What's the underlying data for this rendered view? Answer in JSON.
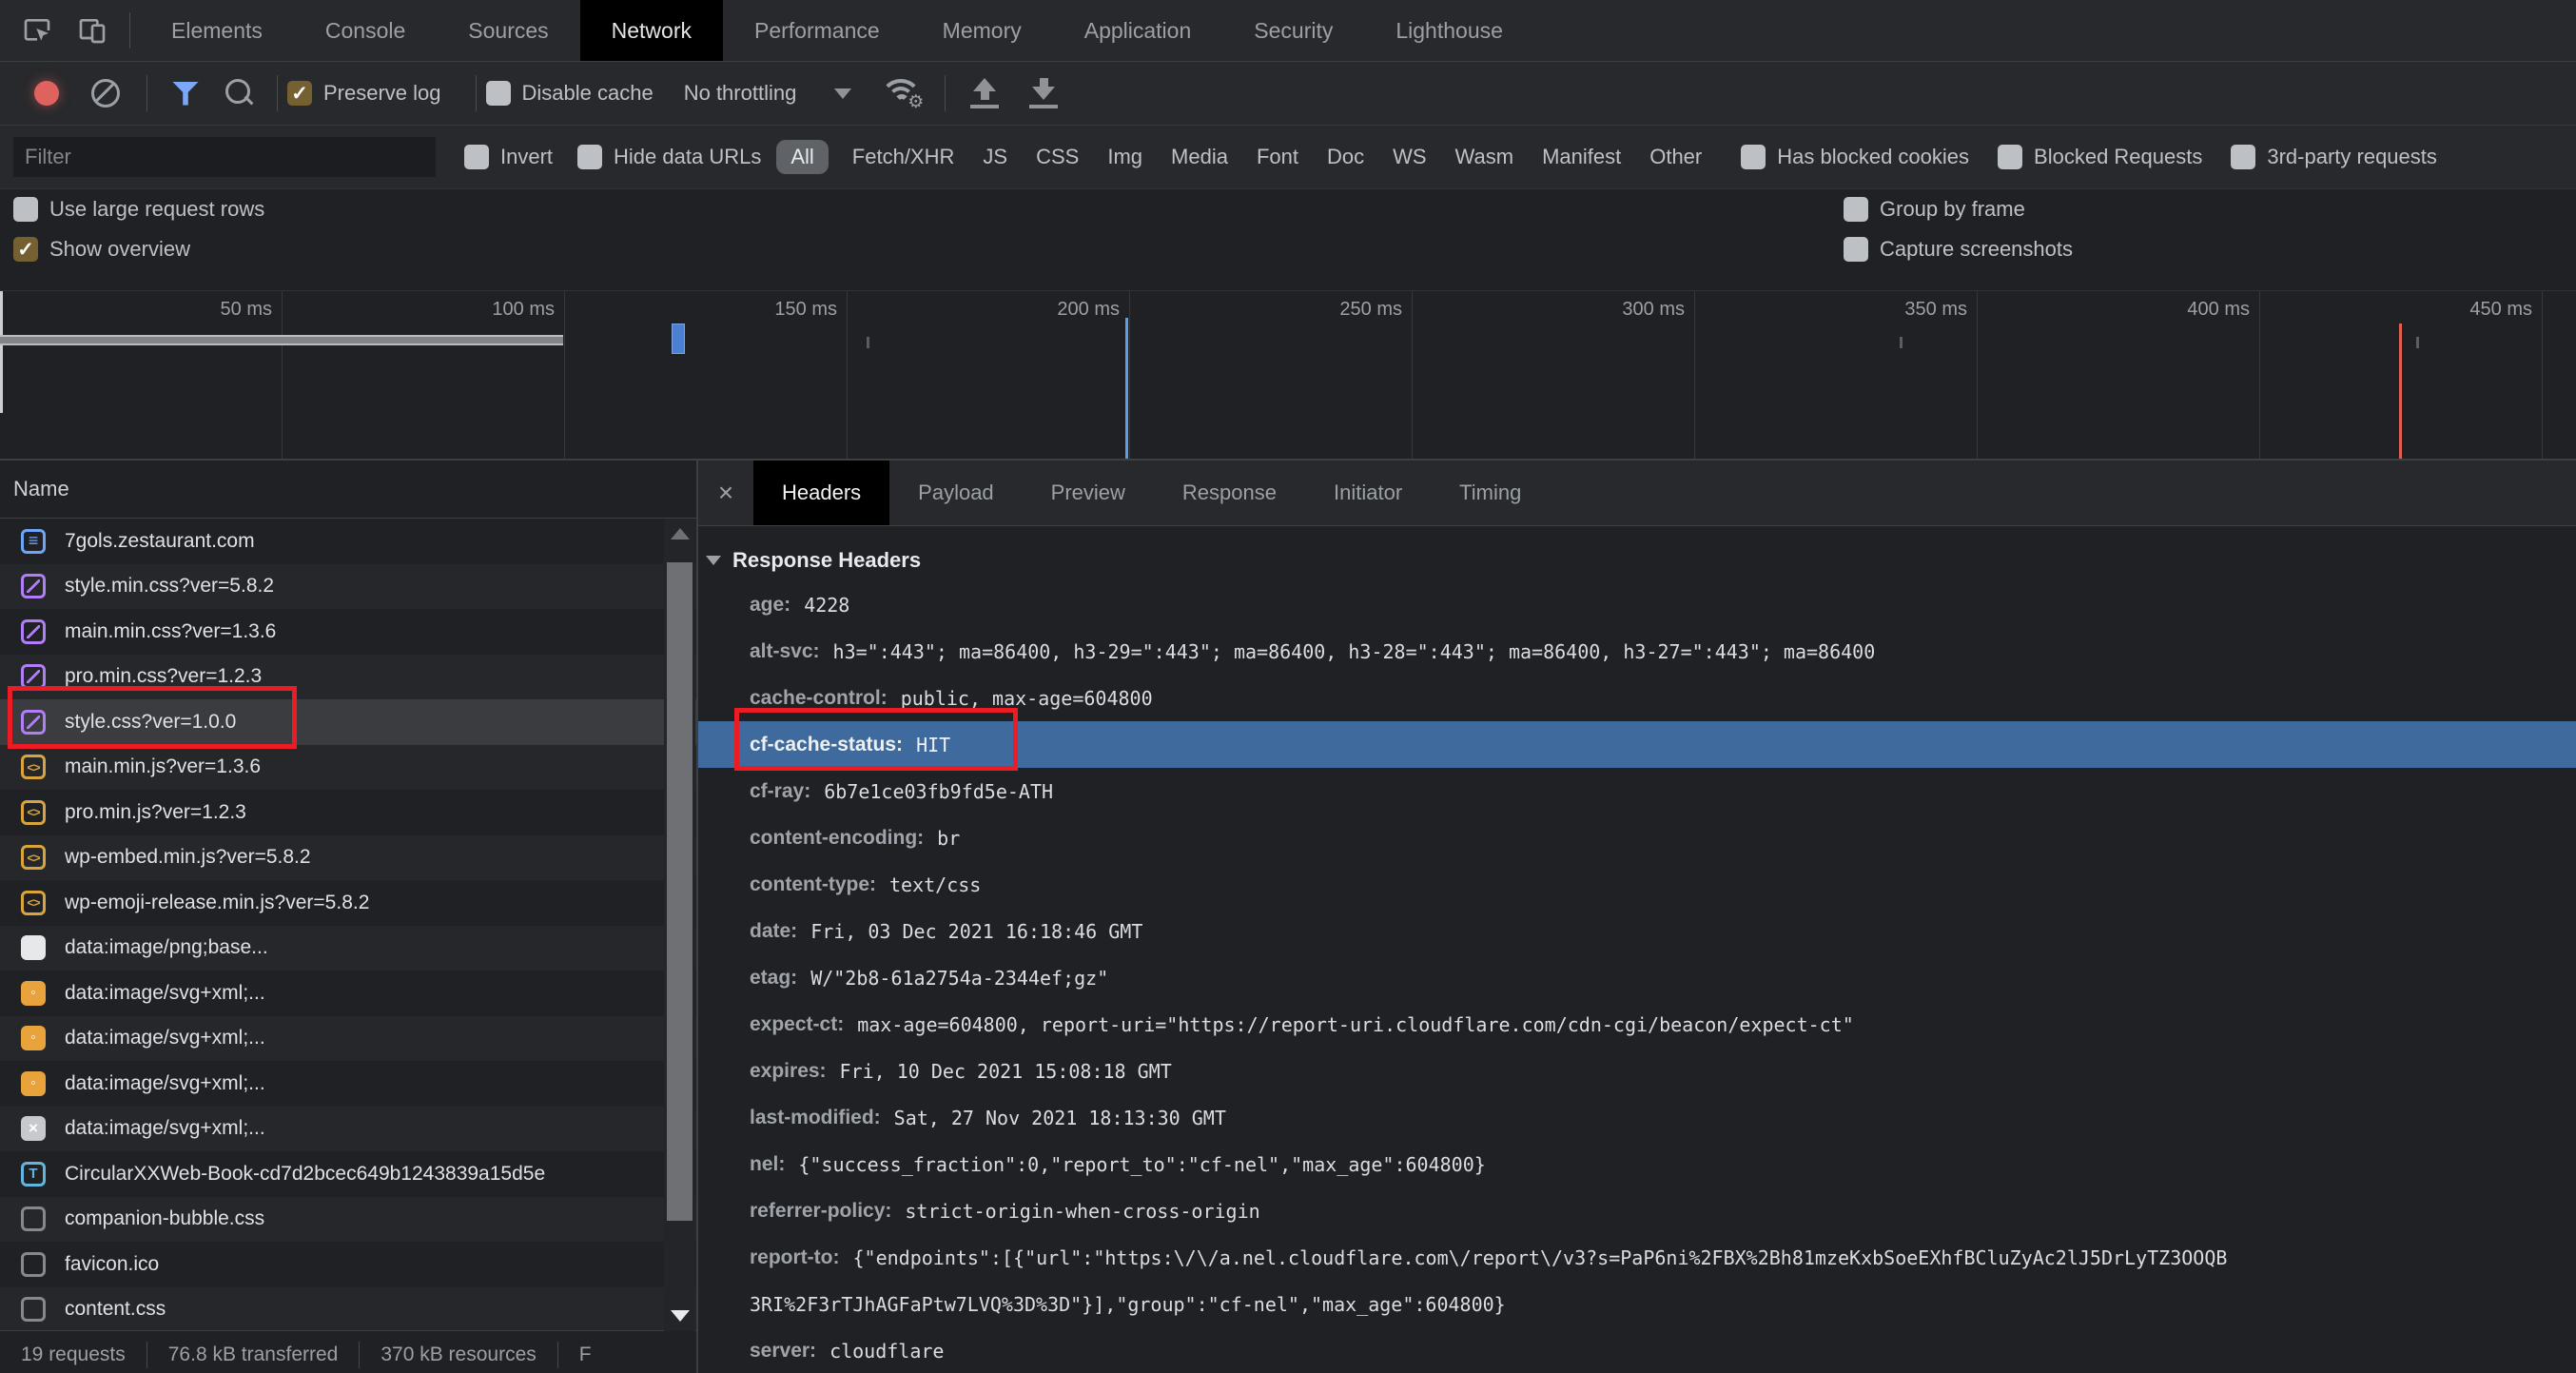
{
  "main_tabs": {
    "items": [
      "Elements",
      "Console",
      "Sources",
      "Network",
      "Performance",
      "Memory",
      "Application",
      "Security",
      "Lighthouse"
    ],
    "active": "Network"
  },
  "toolbar": {
    "preserve_log": {
      "label": "Preserve log",
      "checked": true
    },
    "disable_cache": {
      "label": "Disable cache",
      "checked": false
    },
    "throttling": "No throttling"
  },
  "filter": {
    "placeholder": "Filter",
    "invert": {
      "label": "Invert",
      "checked": false
    },
    "hide_data_urls": {
      "label": "Hide data URLs",
      "checked": false
    },
    "types": [
      "All",
      "Fetch/XHR",
      "JS",
      "CSS",
      "Img",
      "Media",
      "Font",
      "Doc",
      "WS",
      "Wasm",
      "Manifest",
      "Other"
    ],
    "active_type": "All",
    "has_blocked_cookies": {
      "label": "Has blocked cookies",
      "checked": false
    },
    "blocked_requests": {
      "label": "Blocked Requests",
      "checked": false
    },
    "third_party": {
      "label": "3rd-party requests",
      "checked": false
    }
  },
  "options": {
    "use_large_rows": {
      "label": "Use large request rows",
      "checked": false
    },
    "show_overview": {
      "label": "Show overview",
      "checked": true
    },
    "group_by_frame": {
      "label": "Group by frame",
      "checked": false
    },
    "capture_screenshots": {
      "label": "Capture screenshots",
      "checked": false
    }
  },
  "overview": {
    "time_labels": [
      "50 ms",
      "100 ms",
      "150 ms",
      "200 ms",
      "250 ms",
      "300 ms",
      "350 ms",
      "400 ms",
      "450 ms"
    ],
    "dcl_line_time_ms": 199,
    "load_line_time_ms": 425
  },
  "requests": {
    "column": "Name",
    "rows": [
      {
        "label": "7gols.zestaurant.com",
        "icon": "doc"
      },
      {
        "label": "style.min.css?ver=5.8.2",
        "icon": "css"
      },
      {
        "label": "main.min.css?ver=1.3.6",
        "icon": "css"
      },
      {
        "label": "pro.min.css?ver=1.2.3",
        "icon": "css"
      },
      {
        "label": "style.css?ver=1.0.0",
        "icon": "css",
        "selected": true
      },
      {
        "label": "main.min.js?ver=1.3.6",
        "icon": "js"
      },
      {
        "label": "pro.min.js?ver=1.2.3",
        "icon": "js"
      },
      {
        "label": "wp-embed.min.js?ver=5.8.2",
        "icon": "js"
      },
      {
        "label": "wp-emoji-release.min.js?ver=5.8.2",
        "icon": "js"
      },
      {
        "label": "data:image/png;base...",
        "icon": "img-white"
      },
      {
        "label": "data:image/svg+xml;...",
        "icon": "img-orange"
      },
      {
        "label": "data:image/svg+xml;...",
        "icon": "img-orange"
      },
      {
        "label": "data:image/svg+xml;...",
        "icon": "img-orange"
      },
      {
        "label": "data:image/svg+xml;...",
        "icon": "img-gray"
      },
      {
        "label": "CircularXXWeb-Book-cd7d2bcec649b1243839a15d5e",
        "icon": "font"
      },
      {
        "label": "companion-bubble.css",
        "icon": "plain"
      },
      {
        "label": "favicon.ico",
        "icon": "plain"
      },
      {
        "label": "content.css",
        "icon": "plain"
      }
    ]
  },
  "status": {
    "requests": "19 requests",
    "transferred": "76.8 kB transferred",
    "resources": "370 kB resources",
    "clipped": "F"
  },
  "detail": {
    "close": "×",
    "tabs": [
      "Headers",
      "Payload",
      "Preview",
      "Response",
      "Initiator",
      "Timing"
    ],
    "active_tab": "Headers",
    "section": "Response Headers",
    "headers": [
      {
        "n": "age:",
        "v": "4228"
      },
      {
        "n": "alt-svc:",
        "v": "h3=\":443\"; ma=86400, h3-29=\":443\"; ma=86400, h3-28=\":443\"; ma=86400, h3-27=\":443\"; ma=86400"
      },
      {
        "n": "cache-control:",
        "v": "public, max-age=604800"
      },
      {
        "n": "cf-cache-status:",
        "v": "HIT",
        "selected": true
      },
      {
        "n": "cf-ray:",
        "v": "6b7e1ce03fb9fd5e-ATH"
      },
      {
        "n": "content-encoding:",
        "v": "br"
      },
      {
        "n": "content-type:",
        "v": "text/css"
      },
      {
        "n": "date:",
        "v": "Fri, 03 Dec 2021 16:18:46 GMT"
      },
      {
        "n": "etag:",
        "v": "W/\"2b8-61a2754a-2344ef;gz\""
      },
      {
        "n": "expect-ct:",
        "v": "max-age=604800, report-uri=\"https://report-uri.cloudflare.com/cdn-cgi/beacon/expect-ct\""
      },
      {
        "n": "expires:",
        "v": "Fri, 10 Dec 2021 15:08:18 GMT"
      },
      {
        "n": "last-modified:",
        "v": "Sat, 27 Nov 2021 18:13:30 GMT"
      },
      {
        "n": "nel:",
        "v": "{\"success_fraction\":0,\"report_to\":\"cf-nel\",\"max_age\":604800}"
      },
      {
        "n": "referrer-policy:",
        "v": "strict-origin-when-cross-origin"
      },
      {
        "n": "report-to:",
        "v": "{\"endpoints\":[{\"url\":\"https:\\/\\/a.nel.cloudflare.com\\/report\\/v3?s=PaP6ni%2FBX%2Bh81mzeKxbSoeEXhfBCluZyAc2lJ5DrLyTZ3OOQB"
      },
      {
        "n": "",
        "v": "3RI%2F3rTJhAGFaPtw7LVQ%3D%3D\"}],\"group\":\"cf-nel\",\"max_age\":604800}"
      },
      {
        "n": "server:",
        "v": "cloudflare"
      }
    ]
  },
  "colors": {
    "selection_blue": "#3e6a9d",
    "annotation_red": "#ec1c24",
    "record_red": "#e0625e",
    "checkbox_checked": "#746031",
    "active_filter_pill": "#5f6368",
    "dcl_line_blue": "#5aa0e8",
    "load_line_red": "#e0614f"
  }
}
